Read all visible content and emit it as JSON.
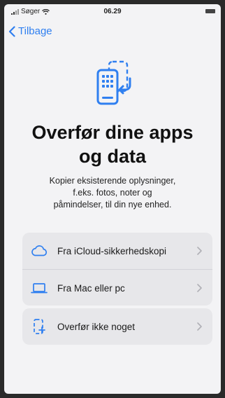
{
  "status_bar": {
    "carrier": "Søger",
    "time": "06.29"
  },
  "nav": {
    "back_label": "Tilbage"
  },
  "hero": {
    "icon": "phone-transfer-icon",
    "title_line1": "Overfør dine apps",
    "title_line2": "og data",
    "subtitle_line1": "Kopier eksisterende oplysninger,",
    "subtitle_line2": "f.eks. fotos, noter og",
    "subtitle_line3": "påmindelser, til din nye enhed."
  },
  "options": [
    {
      "label": "Fra iCloud-sikkerhedskopi",
      "icon": "cloud-icon"
    },
    {
      "label": "Fra Mac eller pc",
      "icon": "laptop-icon"
    },
    {
      "label": "Overfør ikke noget",
      "icon": "new-phone-sparkle-icon"
    }
  ],
  "colors": {
    "accent": "#2f7ff0",
    "background": "#f3f3f5",
    "row_background": "#e7e7ea"
  }
}
